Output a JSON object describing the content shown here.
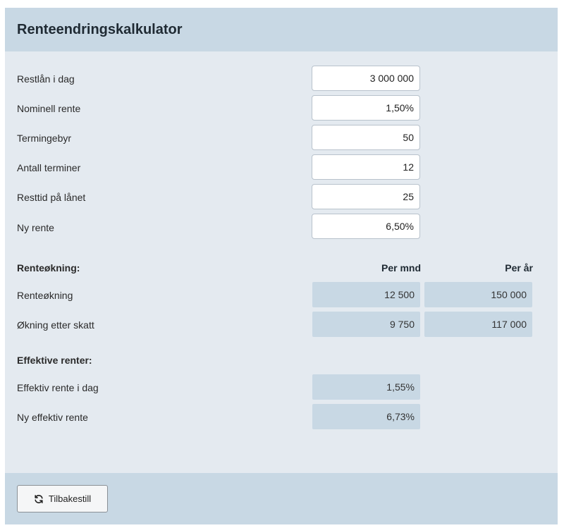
{
  "header": {
    "title": "Renteendringskalkulator"
  },
  "inputs": [
    {
      "label": "Restlån i dag",
      "value": "3 000 000"
    },
    {
      "label": "Nominell rente",
      "value": "1,50%"
    },
    {
      "label": "Termingebyr",
      "value": "50"
    },
    {
      "label": "Antall terminer",
      "value": "12"
    },
    {
      "label": "Resttid på lånet",
      "value": "25"
    },
    {
      "label": "Ny rente",
      "value": "6,50%"
    }
  ],
  "increase": {
    "heading": "Renteøkning:",
    "col_month": "Per mnd",
    "col_year": "Per år",
    "rows": [
      {
        "label": "Renteøkning",
        "month": "12 500",
        "year": "150 000"
      },
      {
        "label": "Økning etter skatt",
        "month": "9 750",
        "year": "117 000"
      }
    ]
  },
  "effective": {
    "heading": "Effektive renter:",
    "rows": [
      {
        "label": "Effektiv rente i dag",
        "value": "1,55%"
      },
      {
        "label": "Ny effektiv rente",
        "value": "6,73%"
      }
    ]
  },
  "footer": {
    "reset_label": "Tilbakestill",
    "reset_icon": "refresh-icon"
  }
}
